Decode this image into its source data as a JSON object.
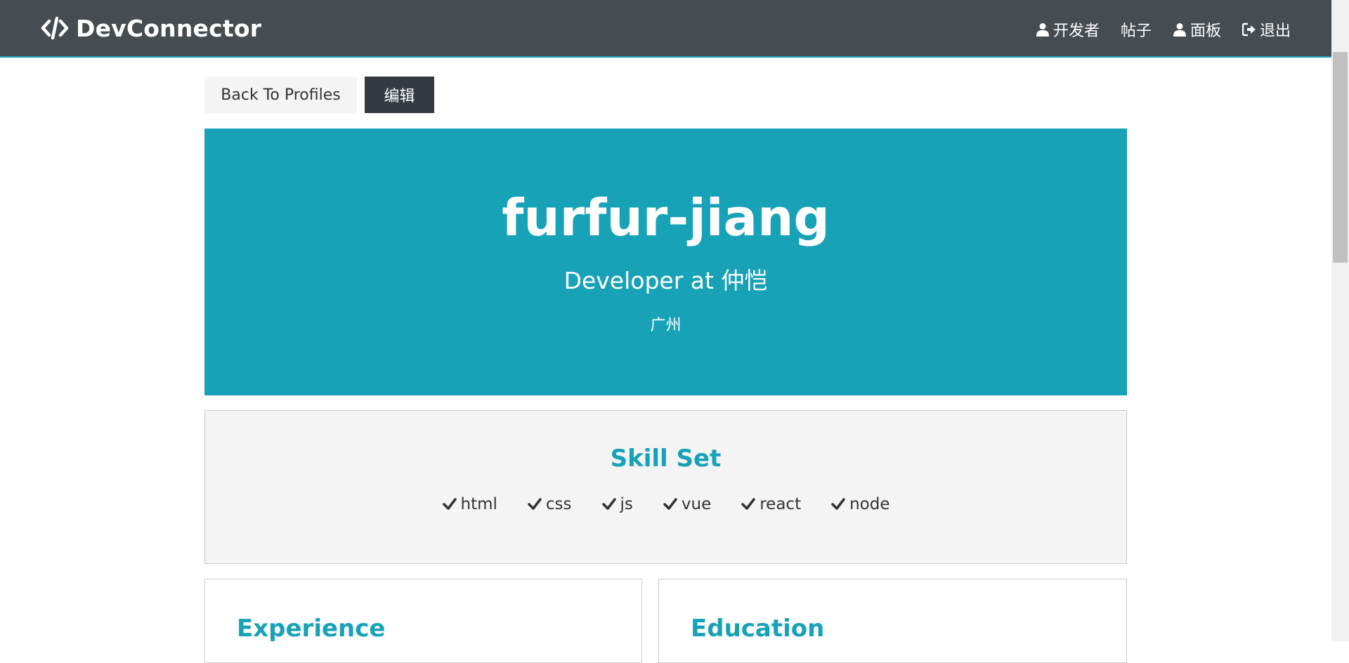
{
  "navbar": {
    "brand": "DevConnector",
    "links": [
      {
        "label": "开发者",
        "icon": "user-icon"
      },
      {
        "label": "帖子",
        "icon": ""
      },
      {
        "label": "面板",
        "icon": "user-icon"
      },
      {
        "label": "退出",
        "icon": "sign-out-icon"
      }
    ]
  },
  "actions": {
    "back_label": "Back To Profiles",
    "edit_label": "编辑"
  },
  "profile": {
    "name": "furfur-jiang",
    "status": "Developer at 仲恺",
    "location": "广州"
  },
  "skills": {
    "title": "Skill Set",
    "items": [
      "html",
      "css",
      "js",
      "vue",
      "react",
      "node"
    ]
  },
  "sections": {
    "experience_title": "Experience",
    "education_title": "Education"
  },
  "colors": {
    "primary": "#17a2b8",
    "navbar": "#474c51",
    "dark": "#343a40",
    "light": "#f4f4f4"
  }
}
